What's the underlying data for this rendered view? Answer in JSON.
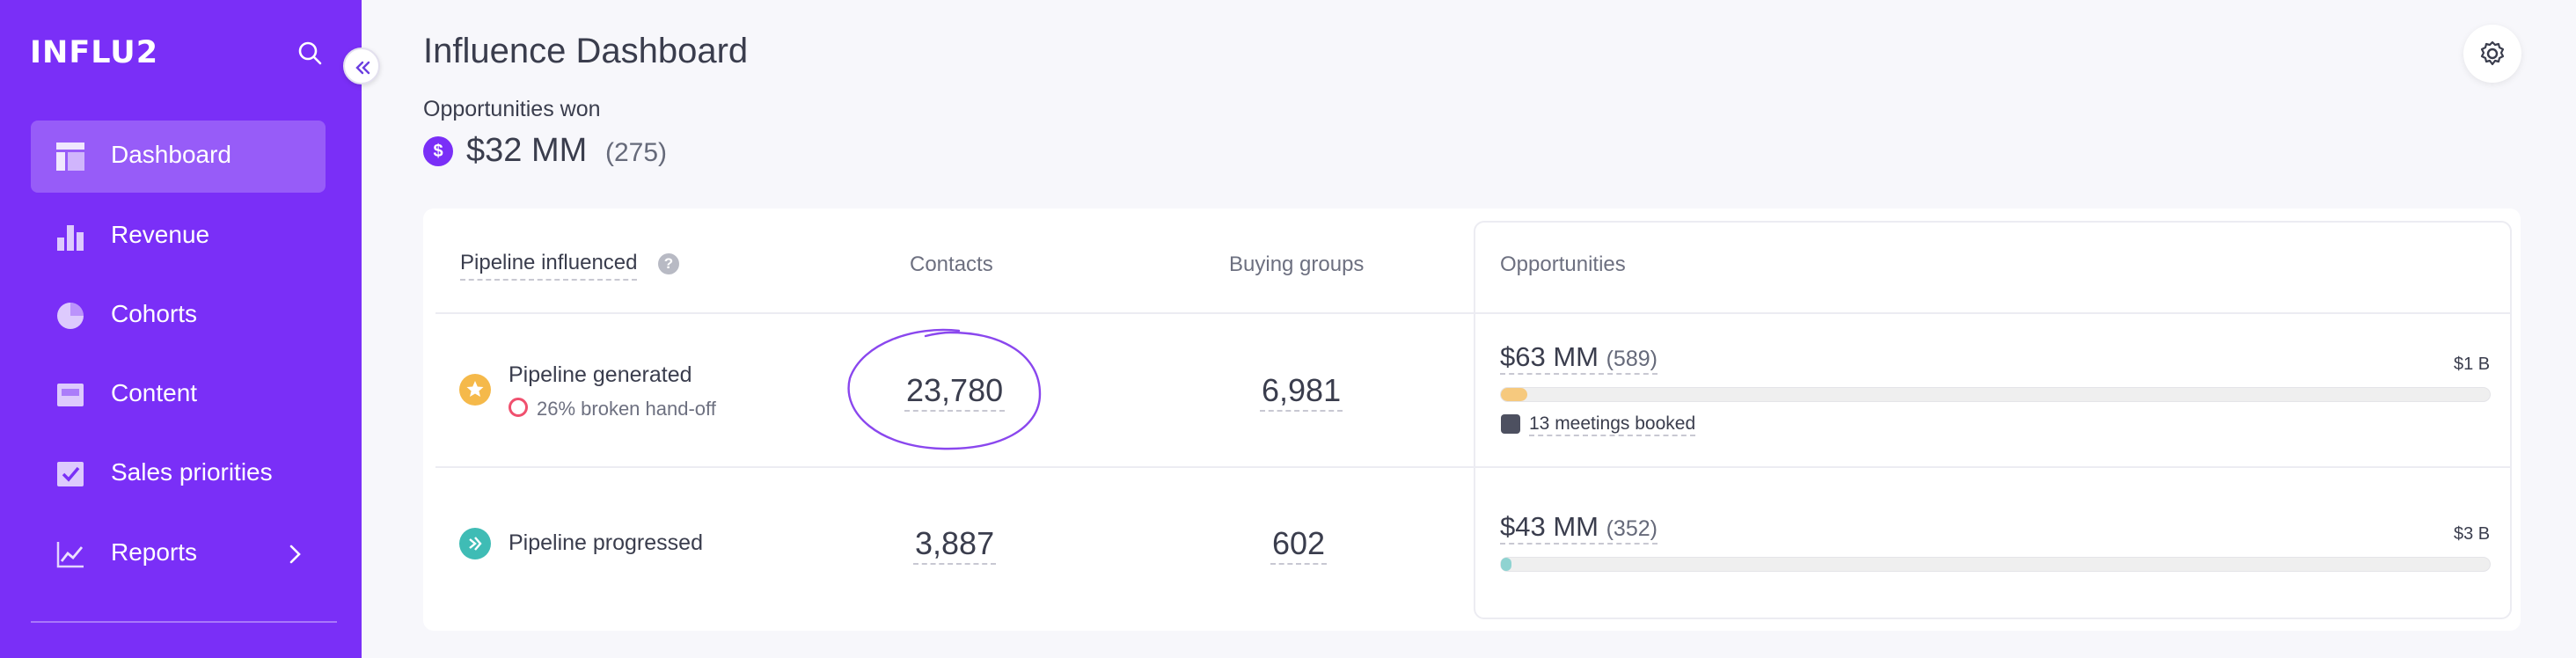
{
  "app": {
    "name": "INFLU2"
  },
  "sidebar": {
    "items": [
      {
        "label": "Dashboard",
        "icon": "dashboard-icon",
        "active": true
      },
      {
        "label": "Revenue",
        "icon": "bar-chart-icon"
      },
      {
        "label": "Cohorts",
        "icon": "pie-chart-icon"
      },
      {
        "label": "Content",
        "icon": "content-icon"
      },
      {
        "label": "Sales priorities",
        "icon": "checkbox-icon"
      },
      {
        "label": "Reports",
        "icon": "line-chart-icon"
      }
    ]
  },
  "header": {
    "title": "Influence Dashboard"
  },
  "summary": {
    "label": "Opportunities won",
    "badge": "$",
    "value": "$32 MM",
    "count": "(275)"
  },
  "table": {
    "columns": {
      "pipeline": "Pipeline influenced",
      "contacts": "Contacts",
      "buying_groups": "Buying groups",
      "opportunities": "Opportunities"
    },
    "help": "?",
    "rows": [
      {
        "title": "Pipeline generated",
        "subtitle": "26% broken hand-off",
        "contacts": "23,780",
        "buying_groups": "6,981",
        "opp_value": "$63 MM",
        "opp_count": "(589)",
        "opp_max": "$1 B",
        "bar_fraction": 0.027,
        "bar_color": "#f6c97e",
        "meetings": "13 meetings booked"
      },
      {
        "title": "Pipeline progressed",
        "contacts": "3,887",
        "buying_groups": "602",
        "opp_value": "$43 MM",
        "opp_count": "(352)",
        "opp_max": "$3 B",
        "bar_fraction": 0.011,
        "bar_color": "#8fd3d1"
      }
    ]
  },
  "colors": {
    "brand": "#7a2ff7",
    "star_badge": "#f5b94a",
    "progress_badge": "#3fbcb5",
    "broken": "#f0506e"
  }
}
